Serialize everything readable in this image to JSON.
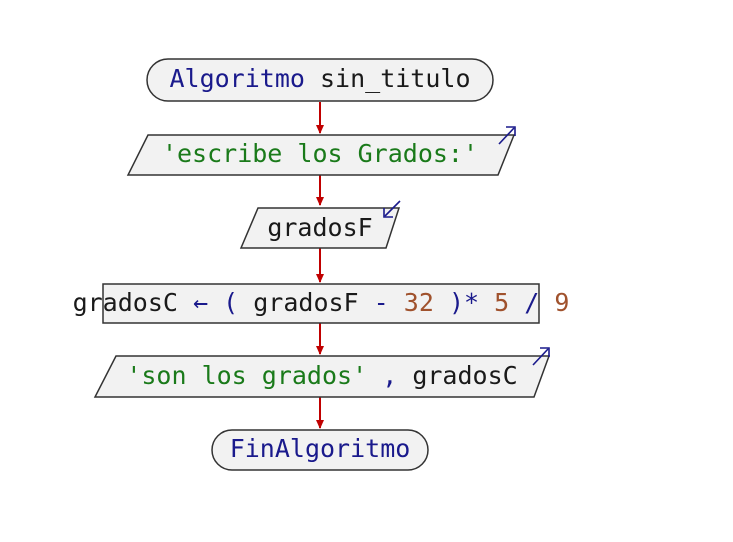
{
  "colors": {
    "keyword": "#1a1a8c",
    "text": "#1a1a1a",
    "string": "#1a7a1a",
    "number": "#a0522d",
    "arrow": "#c00000",
    "io_arrow": "#1a1a8c",
    "shape_fill": "#f2f2f2",
    "shape_stroke": "#333333"
  },
  "start": {
    "keyword": "Algoritmo",
    "name": "sin_titulo"
  },
  "output1": {
    "string": "'escribe los Grados:'"
  },
  "input1": {
    "variable": "gradosF"
  },
  "assign": {
    "target": "gradosC",
    "arrow": "←",
    "open_paren": "(",
    "var": "gradosF",
    "minus": "-",
    "n32": "32",
    "close_paren_times": ")*",
    "n5": "5",
    "slash": "/",
    "n9": "9"
  },
  "output2": {
    "string": "'son los grados'",
    "comma": ",",
    "variable": "gradosC"
  },
  "end": {
    "keyword": "FinAlgoritmo"
  }
}
